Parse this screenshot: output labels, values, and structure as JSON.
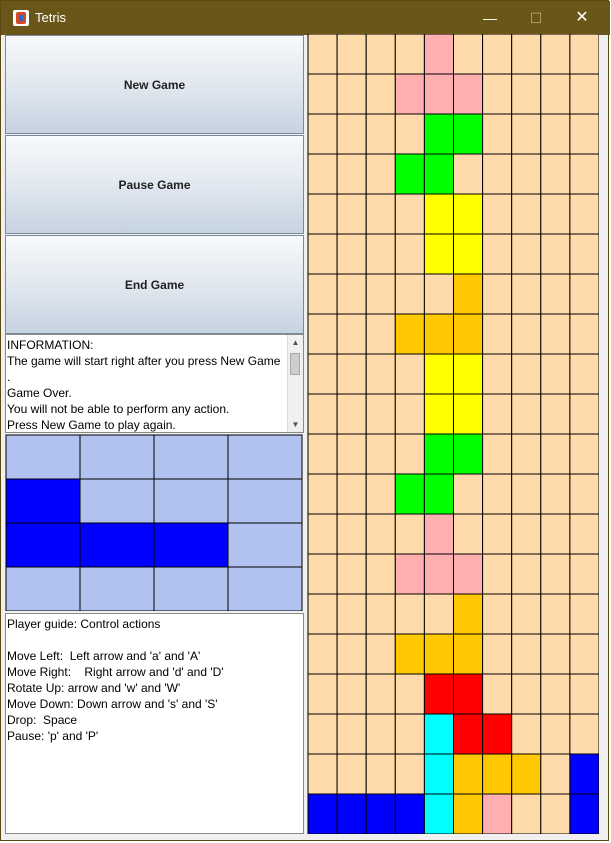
{
  "window": {
    "title": "Tetris"
  },
  "controls": {
    "minimize": "—",
    "maximize": "☐",
    "close": "✕"
  },
  "buttons": {
    "new_game": "New Game",
    "pause_game": "Pause Game",
    "end_game": "End Game"
  },
  "information_lines": [
    "INFORMATION:",
    "The game will start right after you press New Game",
    ".",
    "Game Over.",
    "You will not be able to perform any action.",
    "Press New Game to play again."
  ],
  "guide_lines": [
    "Player guide: Control actions",
    "",
    "Move Left:  Left arrow and 'a' and 'A'",
    "Move Right:    Right arrow and 'd' and 'D'",
    "Rotate Up: arrow and 'w' and 'W'",
    "Move Down: Down arrow and 's' and 'S'",
    "Drop:  Space",
    "Pause: 'p' and 'P'"
  ],
  "colors": {
    ".": "#ffdaaa",
    "P": "#ffafaf",
    "G": "#00ff00",
    "Y": "#ffff00",
    "O": "#ffc800",
    "R": "#ff0000",
    "C": "#00ffff",
    "B": "#0000ff",
    "preview_empty": "#b2c2f0",
    "preview_fill": "#0000ff"
  },
  "next_piece": [
    "....",
    "B...",
    "BBB.",
    "...."
  ],
  "board": [
    "....P.....",
    "...PPP....",
    "....GG....",
    "...GG.....",
    "....YY....",
    "....YY....",
    ".....O....",
    "...OOO....",
    "....YY....",
    "....YY....",
    "....GG....",
    "...GG.....",
    "....P.....",
    "...PPP....",
    ".....O....",
    "...OOO....",
    "....RR....",
    "....CRR...",
    "....COOO.B",
    "BBBBCOP..B"
  ]
}
